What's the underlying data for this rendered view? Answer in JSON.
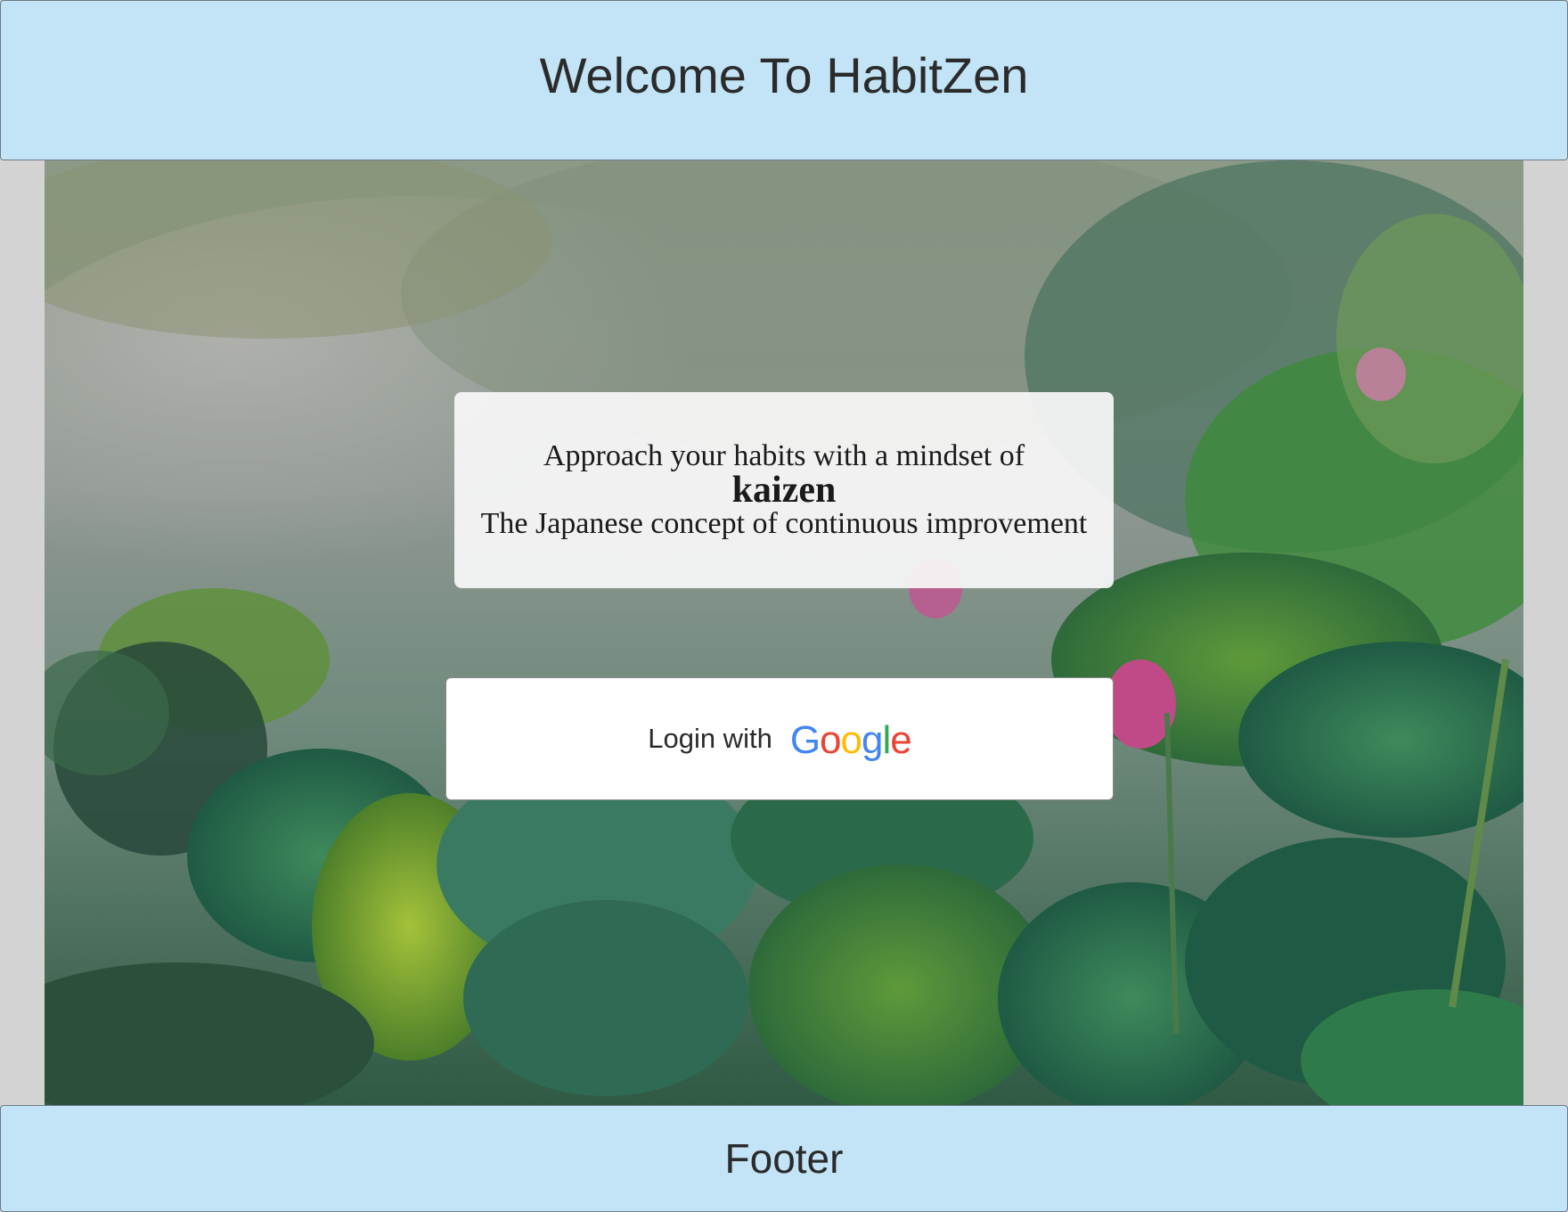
{
  "header": {
    "title": "Welcome To HabitZen"
  },
  "hero": {
    "background_image": "misty lotus pond with green leaves and pink flowers"
  },
  "quote": {
    "line1": "Approach your habits with a mindset of",
    "keyword": "kaizen",
    "line3": "The Japanese concept of continuous improvement"
  },
  "login": {
    "label": "Login with",
    "provider": "Google",
    "provider_letters": [
      {
        "ch": "G",
        "color": "#4285F4"
      },
      {
        "ch": "o",
        "color": "#EA4335"
      },
      {
        "ch": "o",
        "color": "#FBBC05"
      },
      {
        "ch": "g",
        "color": "#4285F4"
      },
      {
        "ch": "l",
        "color": "#34A853"
      },
      {
        "ch": "e",
        "color": "#EA4335"
      }
    ]
  },
  "footer": {
    "text": "Footer"
  },
  "colors": {
    "header_bg": "#c2e4f6",
    "page_bg": "#d3d3d3"
  }
}
